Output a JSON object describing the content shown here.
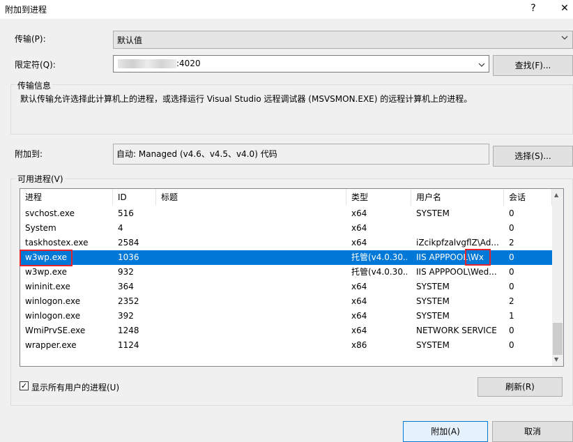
{
  "window": {
    "title": "附加到进程",
    "help": "?",
    "close": "✕"
  },
  "transport": {
    "label": "传输(P):",
    "value": "默认值"
  },
  "qualifier": {
    "label": "限定符(Q):",
    "value": ":4020",
    "find_button": "查找(F)..."
  },
  "transport_info": {
    "title": "传输信息",
    "text": "默认传输允许选择此计算机上的进程，或选择运行 Visual Studio 远程调试器 (MSVSMON.EXE) 的远程计算机上的进程。"
  },
  "attach_to": {
    "label": "附加到:",
    "value": "自动: Managed (v4.6、v4.5、v4.0) 代码",
    "select_button": "选择(S)..."
  },
  "available": {
    "label": "可用进程(V)",
    "columns": [
      "进程",
      "ID",
      "标题",
      "类型",
      "用户名",
      "会话"
    ],
    "rows": [
      {
        "process": "svchost.exe",
        "id": "516",
        "title": "",
        "type": "x64",
        "user": "SYSTEM",
        "session": "0"
      },
      {
        "process": "System",
        "id": "4",
        "title": "",
        "type": "x64",
        "user": "",
        "session": "0"
      },
      {
        "process": "taskhostex.exe",
        "id": "2584",
        "title": "",
        "type": "x64",
        "user": "iZcikpfzalvgflZ\\Ad...",
        "session": "2"
      },
      {
        "process": "w3wp.exe",
        "id": "1036",
        "title": "",
        "type": "托管(v4.0.30...",
        "user": "IIS APPPOOL\\Wx",
        "session": "0"
      },
      {
        "process": "w3wp.exe",
        "id": "932",
        "title": "",
        "type": "托管(v4.0.30...",
        "user": "IIS APPPOOL\\Wed...",
        "session": "0"
      },
      {
        "process": "wininit.exe",
        "id": "364",
        "title": "",
        "type": "x64",
        "user": "SYSTEM",
        "session": "0"
      },
      {
        "process": "winlogon.exe",
        "id": "2352",
        "title": "",
        "type": "x64",
        "user": "SYSTEM",
        "session": "2"
      },
      {
        "process": "winlogon.exe",
        "id": "392",
        "title": "",
        "type": "x64",
        "user": "SYSTEM",
        "session": "1"
      },
      {
        "process": "WmiPrvSE.exe",
        "id": "1248",
        "title": "",
        "type": "x64",
        "user": "NETWORK SERVICE",
        "session": "0"
      },
      {
        "process": "wrapper.exe",
        "id": "1124",
        "title": "",
        "type": "x86",
        "user": "SYSTEM",
        "session": "0"
      }
    ],
    "selected_index": 3
  },
  "show_all": {
    "label": "显示所有用户的进程(U)",
    "checked": true,
    "check_glyph": "✓"
  },
  "refresh_button": "刷新(R)",
  "attach_button": "附加(A)",
  "cancel_button": "取消",
  "icons": {
    "dropdown": "chevron-down-icon",
    "scroll_up": "▲",
    "scroll_down": "▼"
  },
  "colors": {
    "selection": "#0078d7",
    "highlight_box": "#e8232a"
  }
}
